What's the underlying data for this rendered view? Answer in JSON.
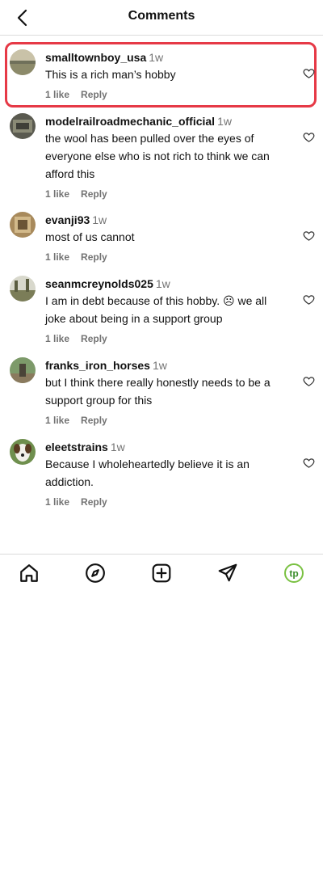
{
  "header": {
    "title": "Comments"
  },
  "comments": [
    {
      "username": "smalltownboy_usa",
      "time": "1w",
      "text": "This is a rich man’s hobby",
      "likes": "1 like",
      "reply": "Reply"
    },
    {
      "username": "modelrailroadmechanic_official",
      "time": "1w",
      "text": "the wool has been pulled over the eyes of everyone else who is not rich to think we can afford this",
      "likes": "1 like",
      "reply": "Reply"
    },
    {
      "username": "evanji93",
      "time": "1w",
      "text": "most of us cannot",
      "likes": "1 like",
      "reply": "Reply"
    },
    {
      "username": "seanmcreynolds025",
      "time": "1w",
      "text": "I am in debt because of this hobby. ☹ we all joke about being in a support group",
      "likes": "1 like",
      "reply": "Reply"
    },
    {
      "username": "franks_iron_horses",
      "time": "1w",
      "text": "but I think there really honestly needs to be a support group for this",
      "likes": "1 like",
      "reply": "Reply"
    },
    {
      "username": "eleetstrains",
      "time": "1w",
      "text": "Because I wholeheartedly believe it is an addiction.",
      "likes": "1 like",
      "reply": "Reply"
    }
  ],
  "nav": {
    "icons": [
      "home-icon",
      "explore-compass-icon",
      "create-plus-icon",
      "send-icon",
      "profile-avatar-icon"
    ],
    "profile_initials": "tp"
  },
  "colors": {
    "highlight": "#e63946",
    "muted": "#737373",
    "profile_accent": "#7ac142"
  }
}
